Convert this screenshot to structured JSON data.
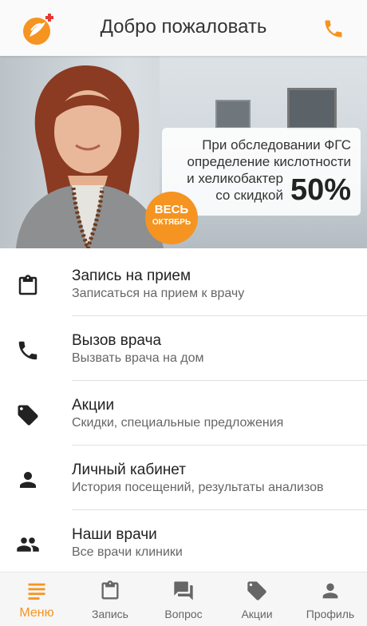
{
  "header": {
    "title": "Добро пожаловать",
    "logo_icon": "clinic-logo-icon",
    "phone_icon": "phone-icon"
  },
  "banner": {
    "line1": "При обследовании ФГС",
    "line2": "определение кислотности",
    "line3": "и хеликобактер",
    "line4": "со скидкой",
    "discount": "50%",
    "badge_line1": "ВЕСЬ",
    "badge_line2": "ОКТЯБРЬ"
  },
  "menu": {
    "items": [
      {
        "title": "Запись на прием",
        "subtitle": "Записаться на прием к врачу",
        "icon": "clipboard-icon"
      },
      {
        "title": "Вызов врача",
        "subtitle": "Вызвать врача на дом",
        "icon": "phone-icon"
      },
      {
        "title": "Акции",
        "subtitle": "Скидки, специальные предложения",
        "icon": "tags-icon"
      },
      {
        "title": "Личный кабинет",
        "subtitle": "История посещений, результаты анализов",
        "icon": "person-icon"
      },
      {
        "title": "Наши врачи",
        "subtitle": "Все врачи клиники",
        "icon": "people-icon"
      }
    ]
  },
  "tabbar": {
    "tabs": [
      {
        "label": "Меню",
        "icon": "menu-lines-icon",
        "active": true
      },
      {
        "label": "Запись",
        "icon": "clipboard-icon"
      },
      {
        "label": "Вопрос",
        "icon": "chat-icon"
      },
      {
        "label": "Акции",
        "icon": "tag-icon"
      },
      {
        "label": "Профиль",
        "icon": "person-icon"
      }
    ]
  },
  "colors": {
    "accent": "#f59420",
    "text": "#222222",
    "subtext": "#666666"
  }
}
